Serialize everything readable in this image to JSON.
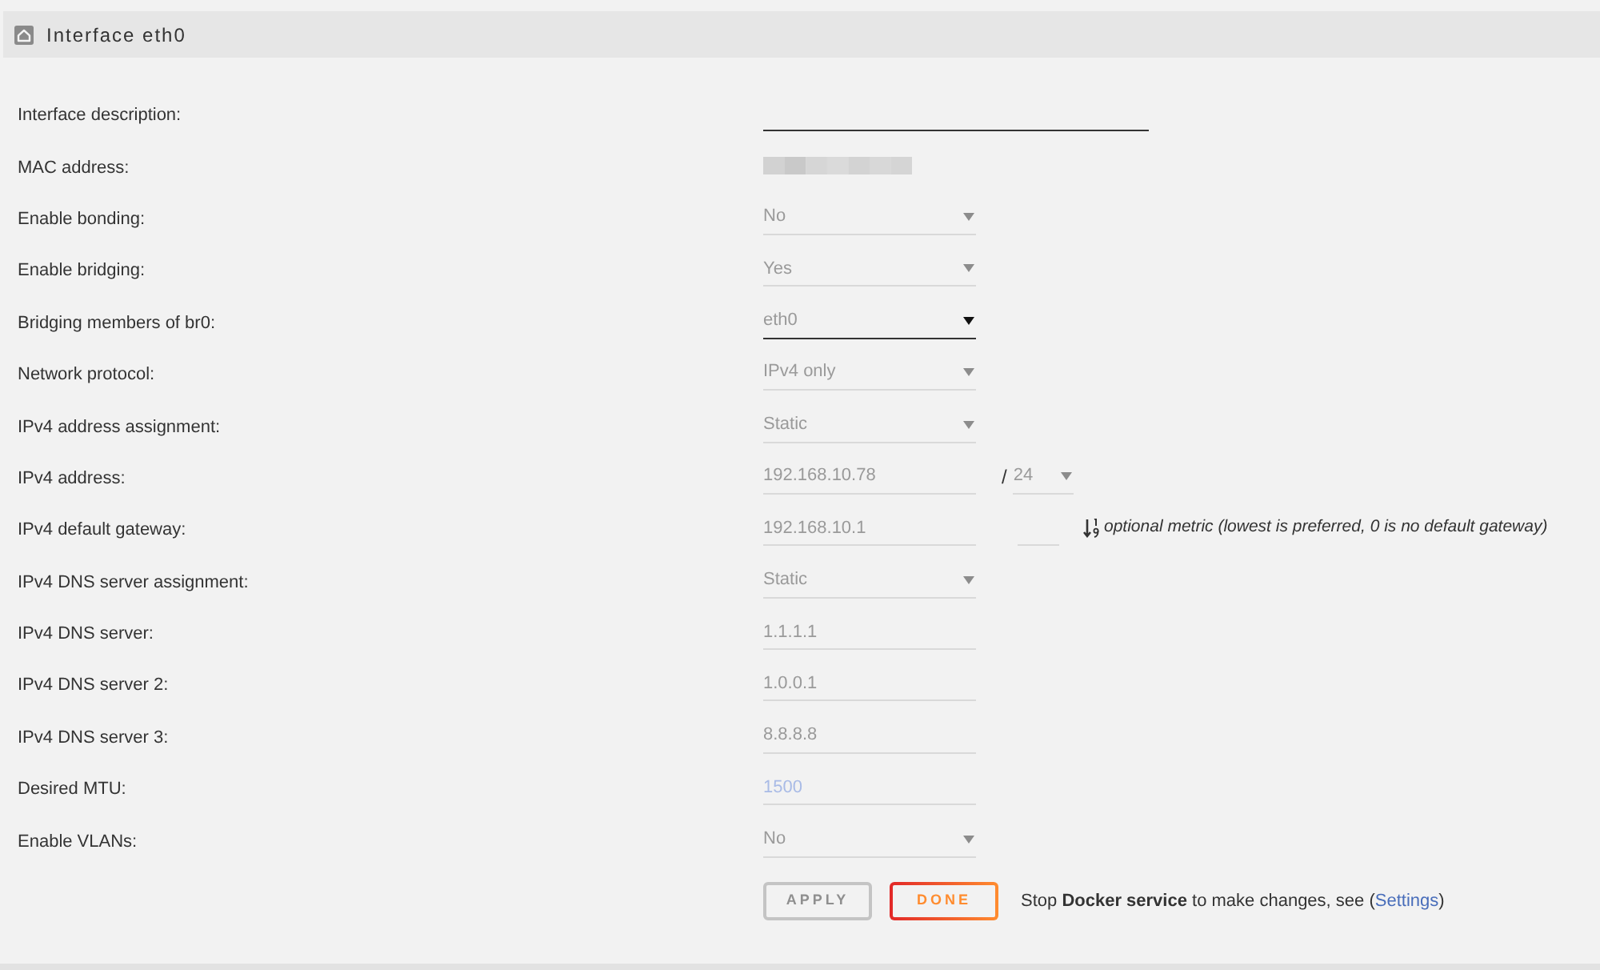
{
  "panel": {
    "title": "Interface eth0"
  },
  "rows": [
    {
      "label": "Interface description:",
      "kind": "longtext",
      "disabled": false
    },
    {
      "label": "MAC address:",
      "kind": "masked"
    },
    {
      "label": "Enable bonding:",
      "kind": "select",
      "value": "No",
      "disabled": true
    },
    {
      "label": "Enable bridging:",
      "kind": "select",
      "value": "Yes",
      "disabled": true
    },
    {
      "label": "Bridging members of br0:",
      "kind": "select",
      "value": "eth0",
      "disabled": false
    },
    {
      "label": "Network protocol:",
      "kind": "select",
      "value": "IPv4 only",
      "disabled": true
    },
    {
      "label": "IPv4 address assignment:",
      "kind": "select",
      "value": "Static",
      "disabled": true
    },
    {
      "label": "IPv4 address:",
      "kind": "address",
      "value": "192.168.10.78",
      "disabled": true,
      "separator": "/",
      "prefix": {
        "value": "24",
        "disabled": true
      }
    },
    {
      "label": "IPv4 default gateway:",
      "kind": "gateway",
      "value": "192.168.10.1",
      "disabled": true,
      "metric": {
        "disabled": true
      },
      "note": "optional metric (lowest is preferred, 0 is no default gateway)"
    },
    {
      "label": "IPv4 DNS server assignment:",
      "kind": "select",
      "value": "Static",
      "disabled": true
    },
    {
      "label": "IPv4 DNS server:",
      "kind": "text",
      "value": "1.1.1.1",
      "disabled": true
    },
    {
      "label": "IPv4 DNS server 2:",
      "kind": "text",
      "value": "1.0.0.1",
      "disabled": true
    },
    {
      "label": "IPv4 DNS server 3:",
      "kind": "text",
      "value": "8.8.8.8",
      "disabled": true
    },
    {
      "label": "Desired MTU:",
      "kind": "text",
      "placeholder": "1500",
      "disabled": true
    },
    {
      "label": "Enable VLANs:",
      "kind": "select",
      "value": "No",
      "disabled": true
    }
  ],
  "actions": {
    "buttons": [
      {
        "label": "APPLY",
        "disabled": true
      },
      {
        "label": "DONE",
        "disabled": false
      }
    ],
    "notice": {
      "text": "Stop **Docker service** to make changes, see (",
      "link": "Settings",
      "closing": ")"
    }
  }
}
